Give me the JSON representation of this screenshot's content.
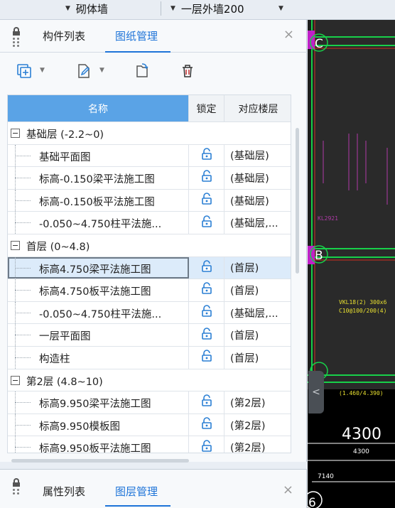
{
  "topbar": {
    "dropdown1": "砌体墙",
    "dropdown2": "一层外墙200"
  },
  "panel": {
    "tabs": [
      "构件列表",
      "图纸管理"
    ],
    "active_tab": "图纸管理"
  },
  "table": {
    "headers": {
      "name": "名称",
      "lock": "锁定",
      "floor": "对应楼层"
    },
    "rows": [
      {
        "type": "group",
        "name": "基础层 (-2.2~0)"
      },
      {
        "type": "item",
        "name": "基础平面图",
        "floor": "(基础层)"
      },
      {
        "type": "item",
        "name": "标高-0.150梁平法施工图",
        "floor": "(基础层)"
      },
      {
        "type": "item",
        "name": "标高-0.150板平法施工图",
        "floor": "(基础层)"
      },
      {
        "type": "item",
        "name": "-0.050~4.750柱平法施...",
        "floor": "(基础层,..."
      },
      {
        "type": "group",
        "name": "首层 (0~4.8)"
      },
      {
        "type": "item",
        "name": "标高4.750梁平法施工图",
        "floor": "(首层)",
        "selected": true
      },
      {
        "type": "item",
        "name": "标高4.750板平法施工图",
        "floor": "(首层)"
      },
      {
        "type": "item",
        "name": "-0.050~4.750柱平法施...",
        "floor": "(基础层,..."
      },
      {
        "type": "item",
        "name": "一层平面图",
        "floor": "(首层)"
      },
      {
        "type": "item",
        "name": "构造柱",
        "floor": "(首层)"
      },
      {
        "type": "group",
        "name": "第2层 (4.8~10)"
      },
      {
        "type": "item",
        "name": "标高9.950梁平法施工图",
        "floor": "(第2层)"
      },
      {
        "type": "item",
        "name": "标高9.950模板图",
        "floor": "(第2层)"
      },
      {
        "type": "item",
        "name": "标高9.950板平法施工图",
        "floor": "(第2层)"
      }
    ]
  },
  "panel2": {
    "tabs": [
      "属性列表",
      "图层管理"
    ],
    "active_tab": "图层管理"
  },
  "canvas": {
    "axis_labels": [
      "C",
      "B",
      "6"
    ],
    "annotations": [
      "KL2921",
      "VKL18(2) 300x6",
      "C10@100/200(4)",
      "(1.460/4.390)",
      "4300",
      "4300",
      "7140"
    ]
  },
  "icons": {
    "add_drawing": "add-drawing-icon",
    "edit_drawing": "edit-drawing-icon",
    "import_drawing": "import-drawing-icon",
    "delete": "trash-icon",
    "lock": "unlocked-padlock-icon",
    "close": "close-icon",
    "collapse": "chevron-left-icon"
  },
  "colors": {
    "accent": "#1e74d8",
    "header_name_bg": "#5aa3e6",
    "selected_row": "#dcebfa",
    "canvas_bg": "#000000",
    "cad_green": "#18d04a",
    "cad_magenta": "#c020c8"
  }
}
